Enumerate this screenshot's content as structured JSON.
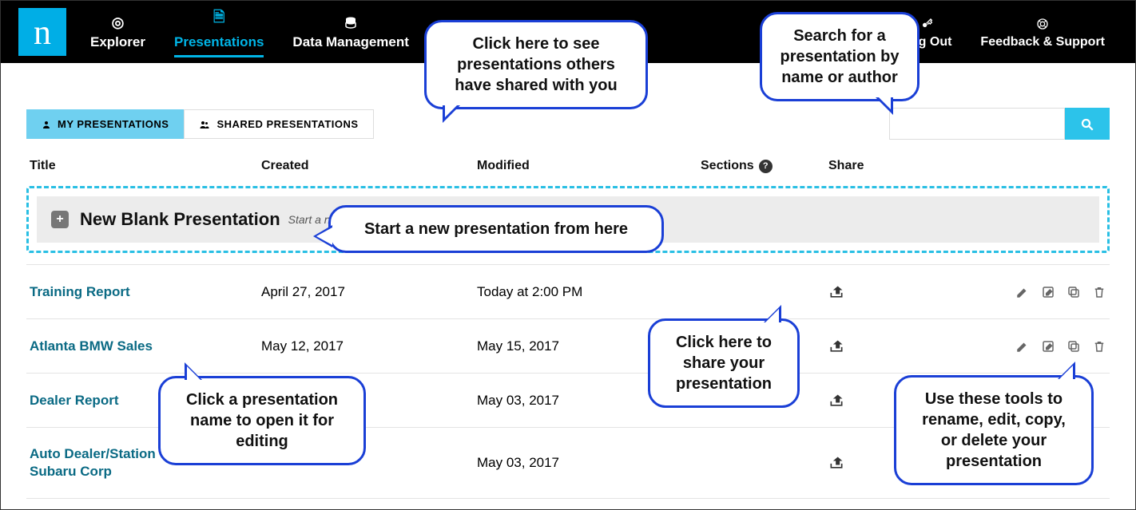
{
  "brand_letter": "n",
  "nav": {
    "explorer": "Explorer",
    "presentations": "Presentations",
    "data_management": "Data Management",
    "logout": "Log Out",
    "feedback": "Feedback & Support"
  },
  "tabs": {
    "my": "MY PRESENTATIONS",
    "shared": "SHARED PRESENTATIONS"
  },
  "search": {
    "placeholder": ""
  },
  "columns": {
    "title": "Title",
    "created": "Created",
    "modified": "Modified",
    "sections": "Sections",
    "share": "Share"
  },
  "new_row": {
    "label": "New Blank Presentation",
    "hint": "Start a new, blank presentation"
  },
  "rows": [
    {
      "title": "Training Report",
      "created": "April 27, 2017",
      "modified": "Today at 2:00 PM",
      "tools": true
    },
    {
      "title": "Atlanta BMW Sales",
      "created": "May 12, 2017",
      "modified": "May 15, 2017",
      "tools": true
    },
    {
      "title": "Dealer Report",
      "created": "",
      "modified": "May 03, 2017",
      "tools": false
    },
    {
      "title": "Auto Dealer/Station - Classic Subaru Corp",
      "created": "",
      "modified": "May 03, 2017",
      "tools": false
    }
  ],
  "callouts": {
    "shared": "Click here to see presentations others have shared with you",
    "search": "Search for a presentation by name or author",
    "new": "Start a new presentation from here",
    "share": "Click here to share your presentation",
    "open": "Click a presentation name to open it for editing",
    "tools": "Use these tools to rename, edit, copy, or delete your presentation"
  }
}
